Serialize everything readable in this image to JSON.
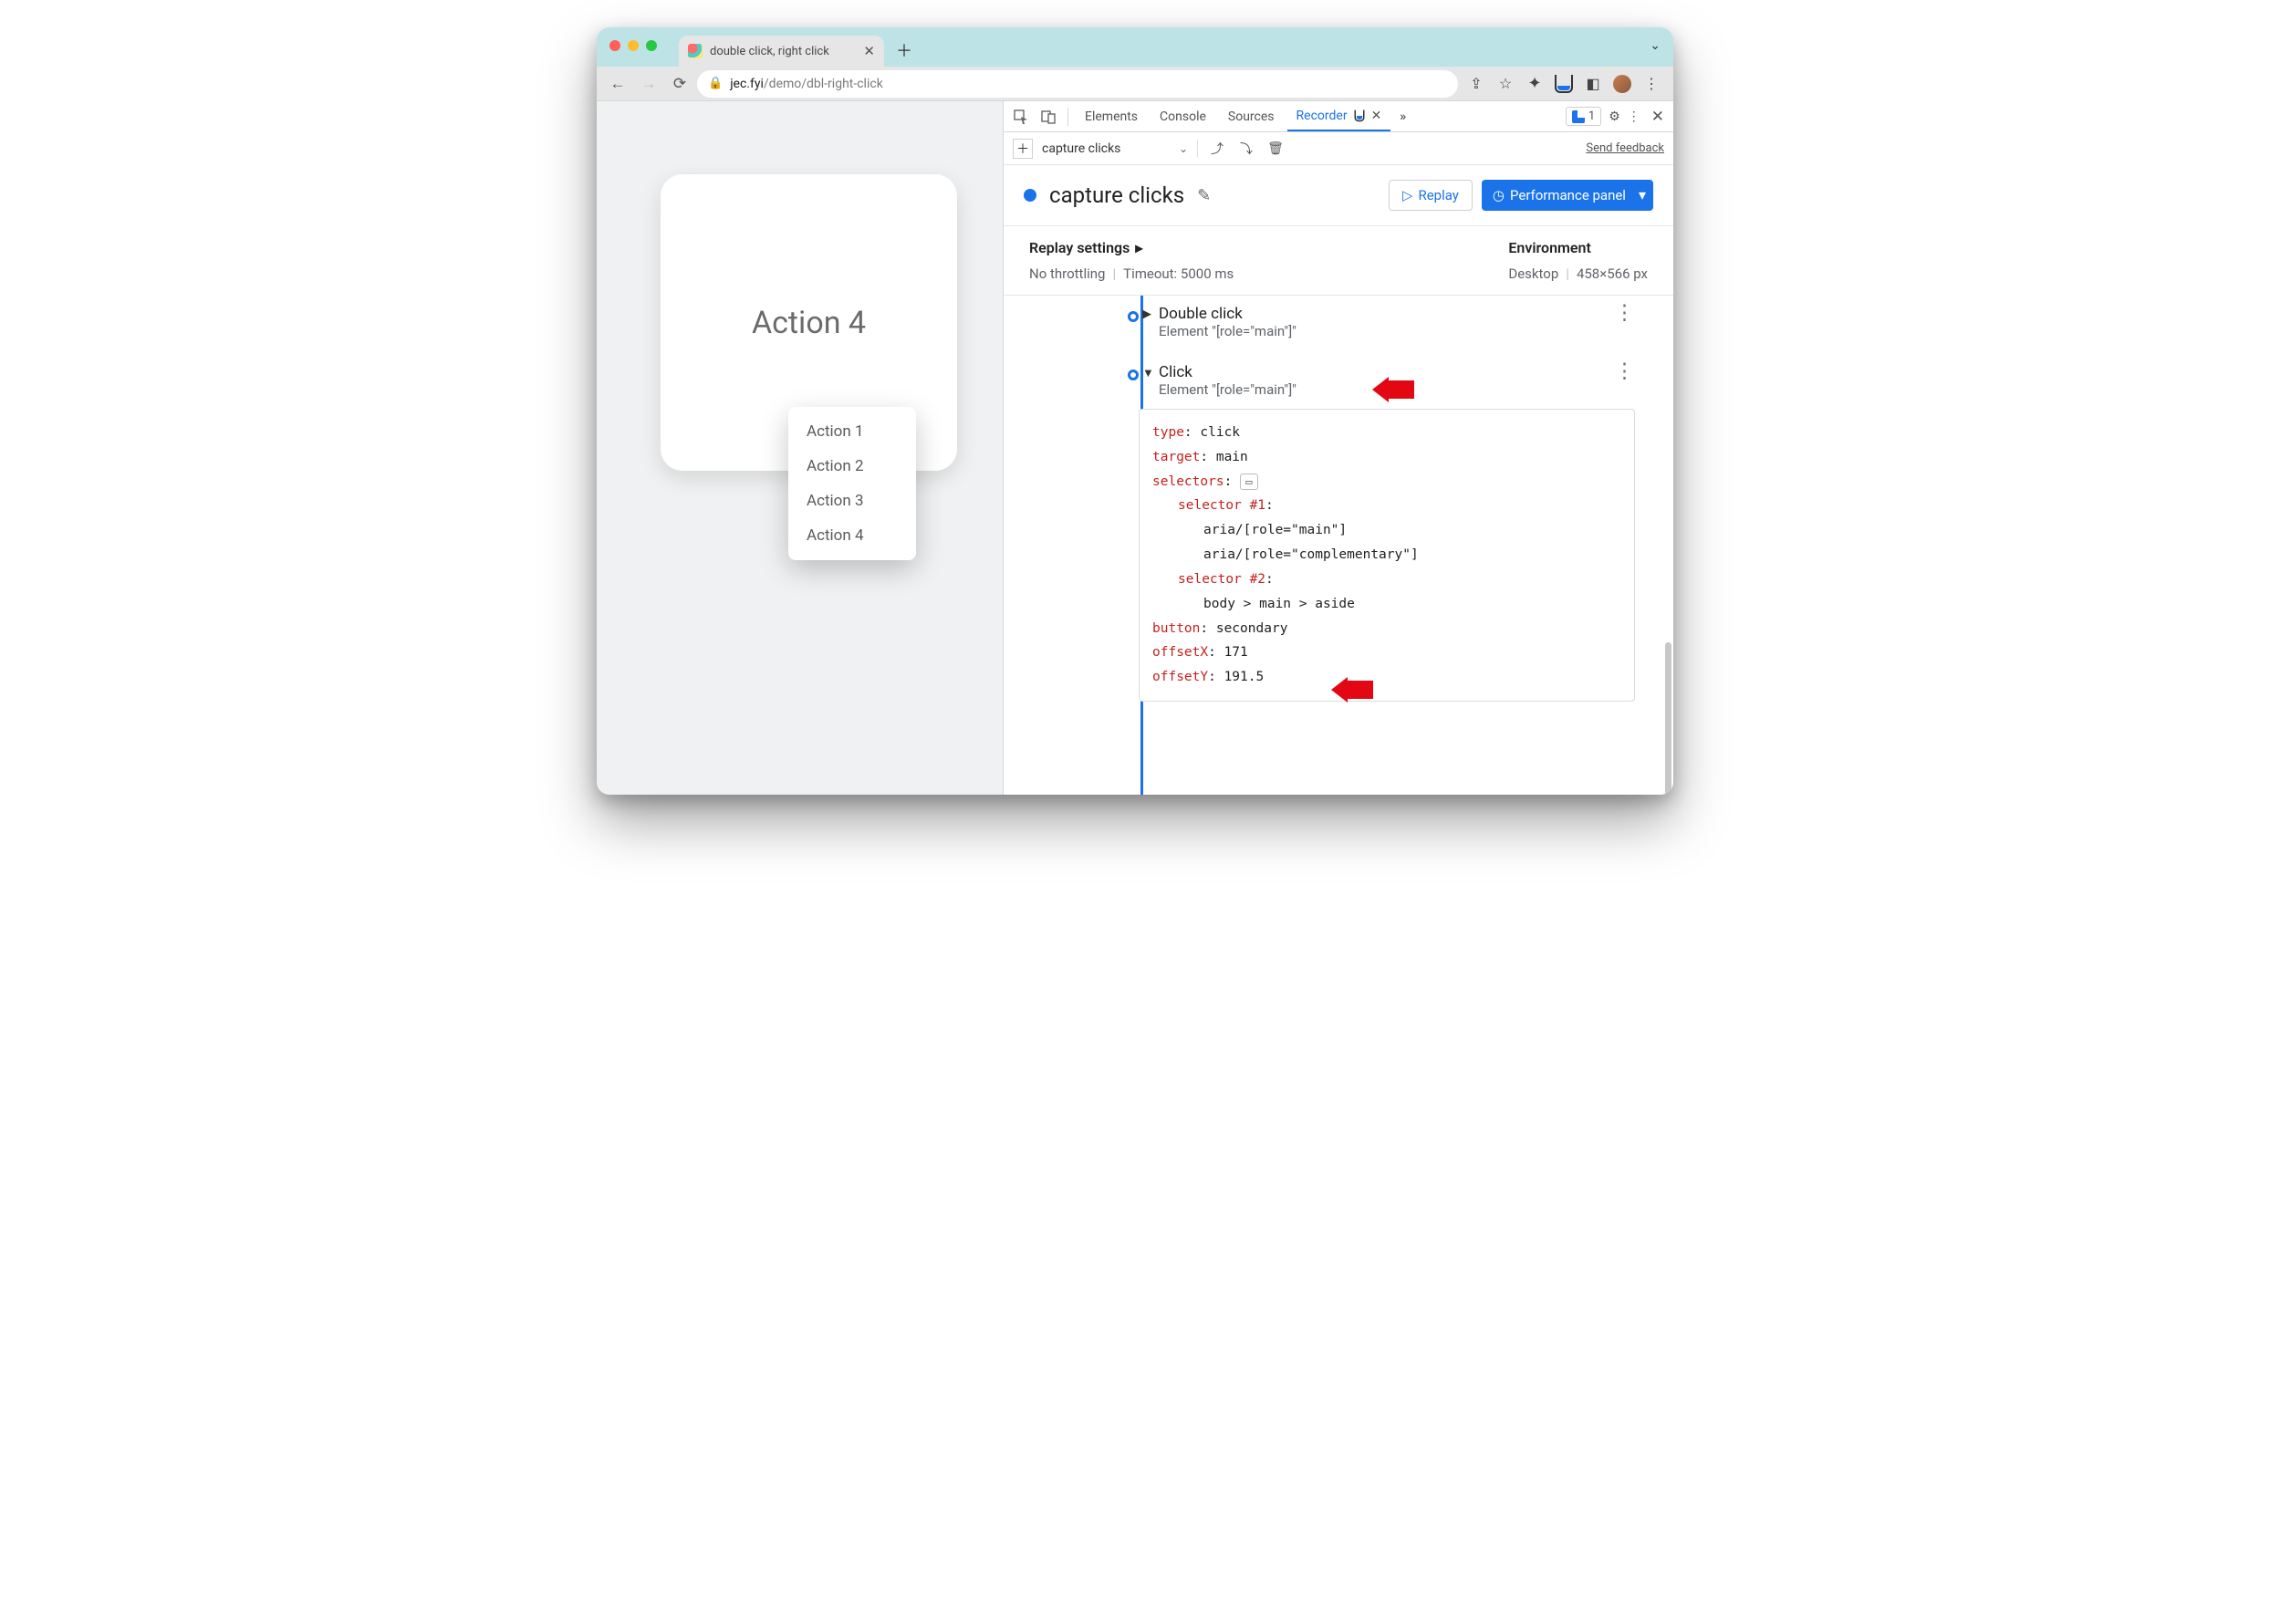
{
  "browser": {
    "tab_title": "double click, right click",
    "url_host": "jec.fyi",
    "url_path": "/demo/dbl-right-click"
  },
  "page": {
    "card_label": "Action 4",
    "context_menu": [
      "Action 1",
      "Action 2",
      "Action 3",
      "Action 4"
    ]
  },
  "devtools": {
    "tabs": {
      "elements": "Elements",
      "console": "Console",
      "sources": "Sources",
      "recorder": "Recorder"
    },
    "issues_count": "1",
    "send_feedback": "Send feedback",
    "recording_dropdown": "capture clicks",
    "recording_title": "capture clicks",
    "replay_button": "Replay",
    "perf_button": "Performance panel",
    "replay_settings_label": "Replay settings",
    "throttling_label": "No throttling",
    "timeout_label": "Timeout: 5000 ms",
    "env_label": "Environment",
    "env_device": "Desktop",
    "env_viewport": "458×566 px",
    "steps": {
      "dblclick": {
        "title": "Double click",
        "subtitle": "Element \"[role=\"main\"]\""
      },
      "click": {
        "title": "Click",
        "subtitle": "Element \"[role=\"main\"]\""
      }
    },
    "panel": {
      "type_k": "type",
      "type_v": ": click",
      "target_k": "target",
      "target_v": ": main",
      "selectors_k": "selectors",
      "selectors_colon": ":",
      "sel1_k": "selector #1",
      "sel1_colon": ":",
      "sel1_a": "aria/[role=\"main\"]",
      "sel1_b": "aria/[role=\"complementary\"]",
      "sel2_k": "selector #2",
      "sel2_colon": ":",
      "sel2_a": "body > main > aside",
      "button_k": "button",
      "button_v": ": secondary",
      "offx_k": "offsetX",
      "offx_v": ": 171",
      "offy_k": "offsetY",
      "offy_v": ": 191.5"
    }
  }
}
